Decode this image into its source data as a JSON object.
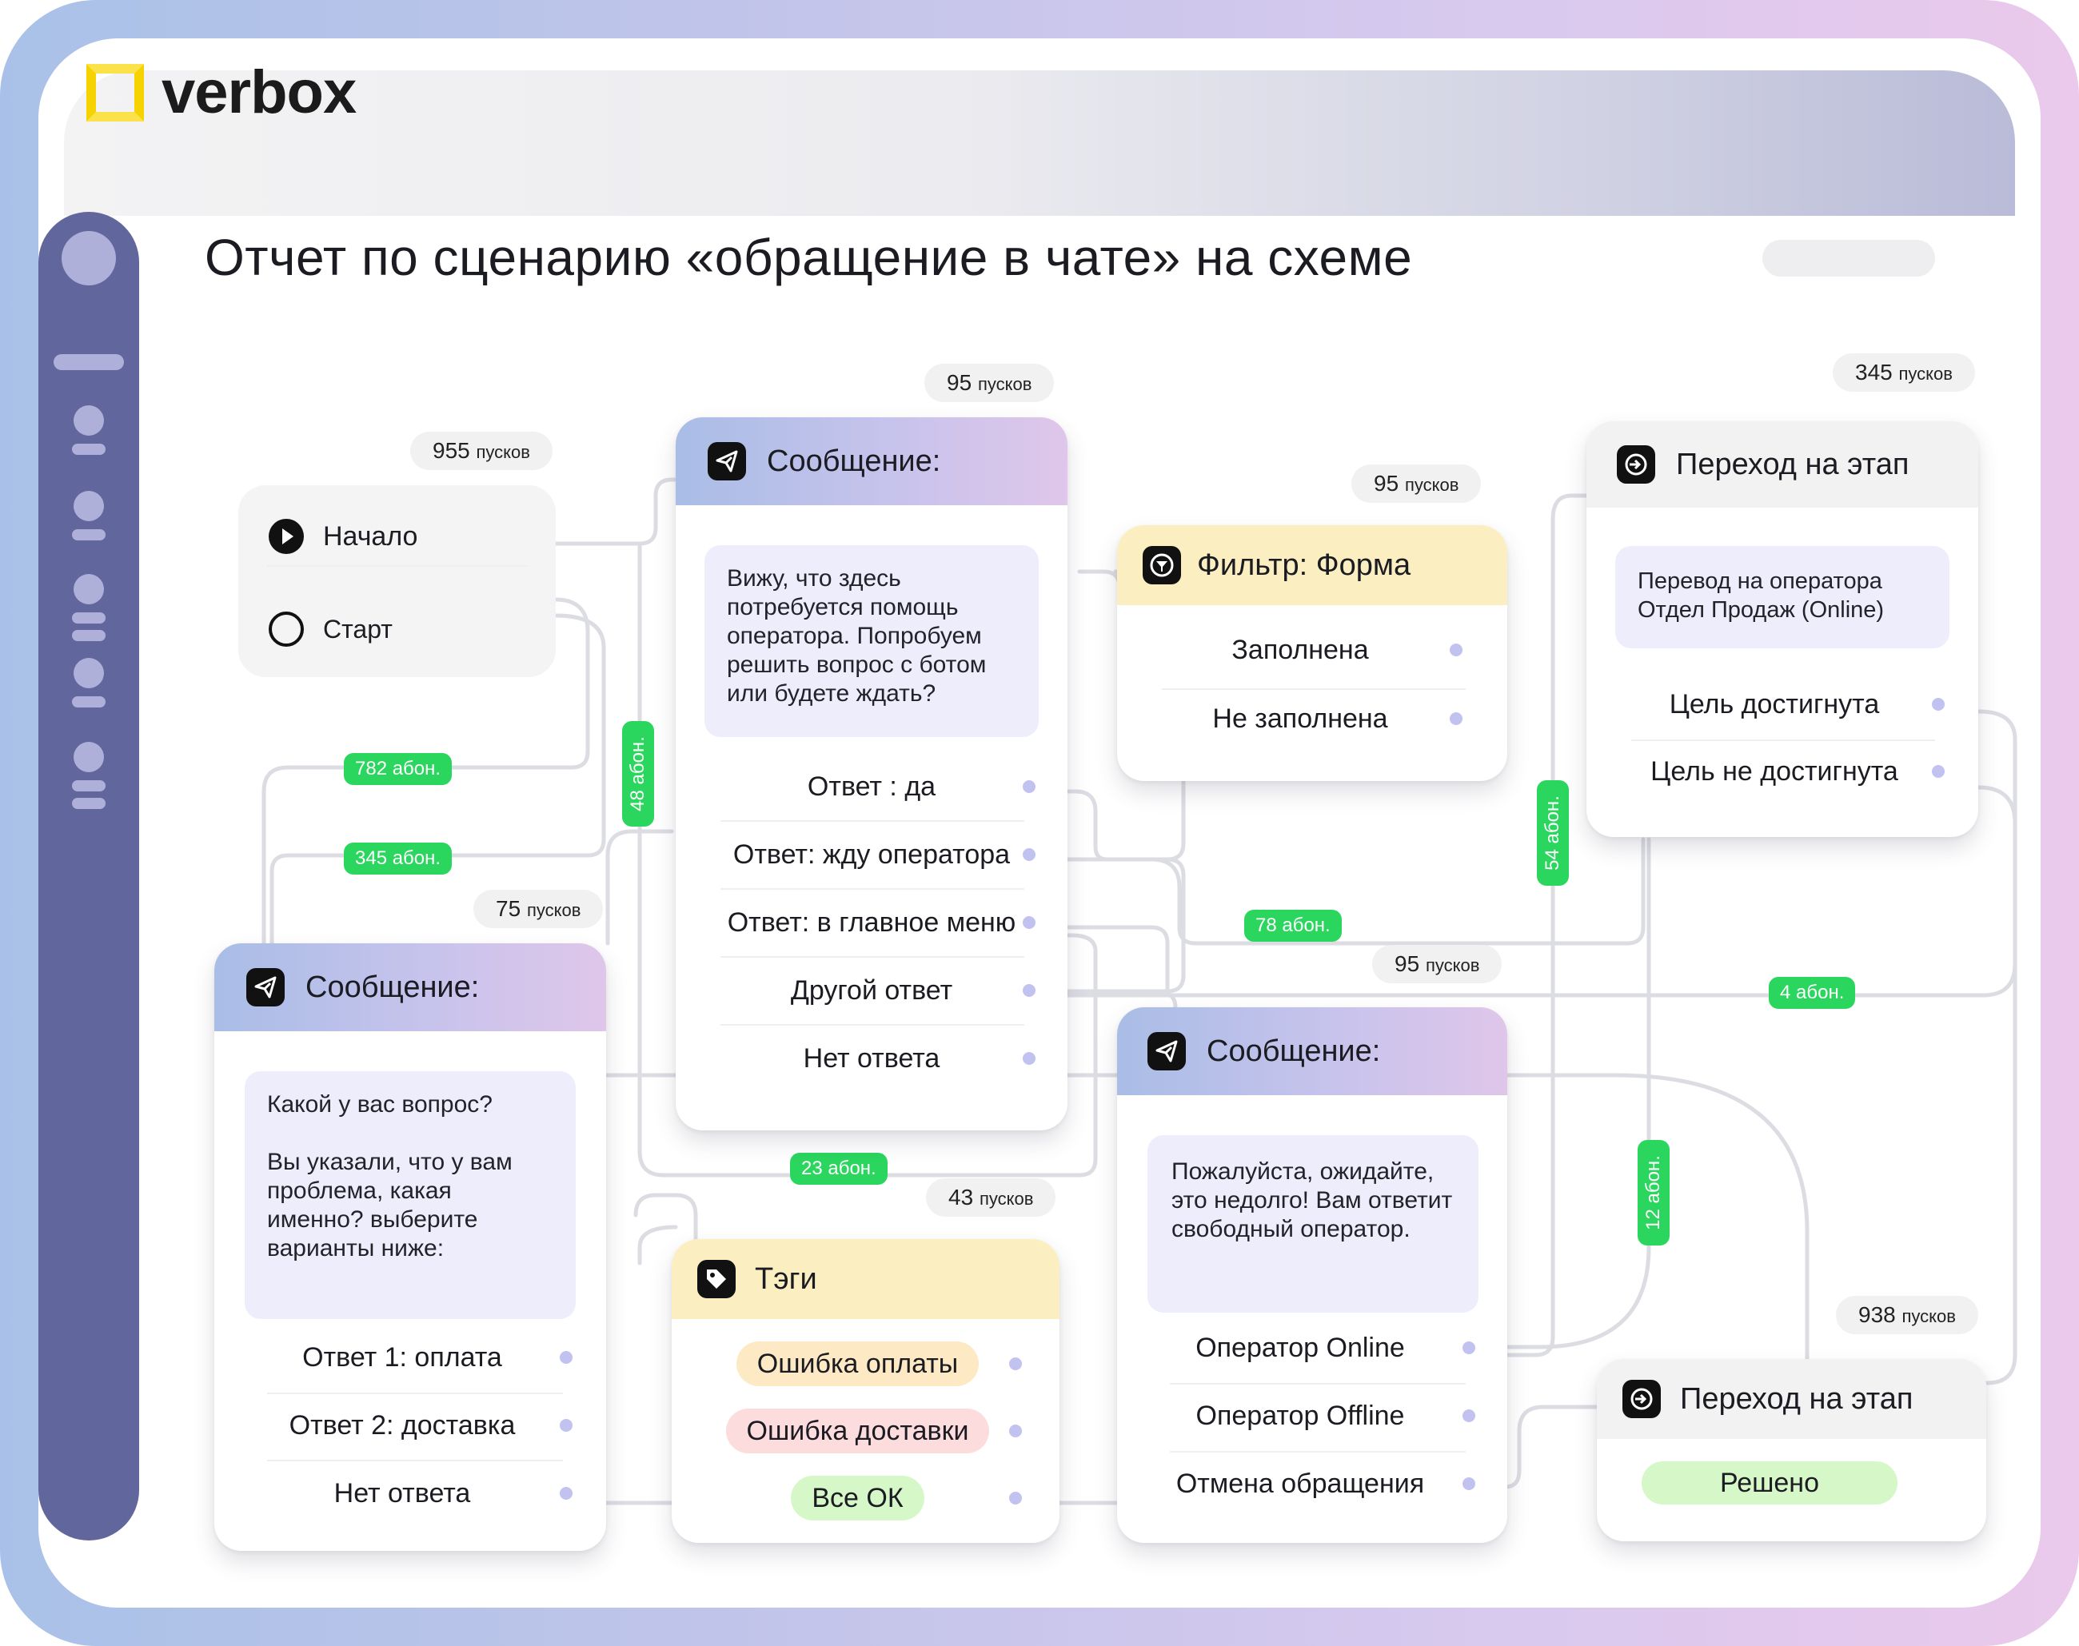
{
  "brand": {
    "name": "verbox",
    "logo_icon": "square-frame-icon",
    "accent": "#fce24a"
  },
  "title": "Отчет по сценарию «обращение в чате» на схеме",
  "sidebar_icons": [
    "avatar-icon",
    "menu-bar",
    "nav-user-icon",
    "nav-user-icon",
    "nav-group-icon",
    "nav-group-icon",
    "nav-group-icon"
  ],
  "counts": {
    "c955": {
      "num": "955",
      "unit": "пусков"
    },
    "c95a": {
      "num": "95",
      "unit": "пусков"
    },
    "c95b": {
      "num": "95",
      "unit": "пусков"
    },
    "c95c": {
      "num": "95",
      "unit": "пусков"
    },
    "c345": {
      "num": "345",
      "unit": "пусков"
    },
    "c75": {
      "num": "75",
      "unit": "пусков"
    },
    "c43": {
      "num": "43",
      "unit": "пусков"
    },
    "c938": {
      "num": "938",
      "unit": "пусков"
    }
  },
  "abonents": {
    "a782": "782 абон.",
    "a345": "345 абон.",
    "a48": "48 абон.",
    "a78": "78 абон.",
    "a54": "54 абон.",
    "a4": "4 абон.",
    "a23": "23 абон.",
    "a12": "12 абон."
  },
  "start_card": {
    "row1": "Начало",
    "row2": "Старт"
  },
  "msg_top": {
    "header": "Сообщение:",
    "bubble": "Вижу, что здесь потребуется помощь оператора.  Попробуем решить вопрос с ботом или будете ждать?",
    "rows": [
      "Ответ : да",
      "Ответ: жду оператора",
      "Ответ: в главное меню",
      "Другой ответ",
      "Нет ответа"
    ]
  },
  "filter_card": {
    "header": "Фильтр: Форма",
    "rows": [
      "Заполнена",
      "Не заполнена"
    ]
  },
  "stage_top": {
    "header": "Переход на этап",
    "bubble_line1": "Перевод на оператора",
    "bubble_line2": "Отдел Продаж (Online)",
    "rows": [
      "Цель достигнута",
      "Цель не достигнута"
    ]
  },
  "msg_left": {
    "header": "Сообщение:",
    "bubble_line1": "Какой у вас вопрос?",
    "bubble_line2": "Вы указали, что у вам проблема, какая именно? выберите варианты ниже:",
    "rows": [
      "Ответ 1: оплата",
      "Ответ 2: доставка",
      "Нет ответа"
    ]
  },
  "tags_card": {
    "header": "Тэги",
    "tags": [
      {
        "label": "Ошибка оплаты",
        "color": "#fde9c4"
      },
      {
        "label": "Ошибка доставки",
        "color": "#fcdcdc"
      },
      {
        "label": "Все ОК",
        "color": "#d6f7c7"
      }
    ]
  },
  "msg_mid": {
    "header": "Сообщение:",
    "bubble": "Пожалуйста, ожидайте, это недолго! Вам ответит свободный оператор.",
    "rows": [
      "Оператор Online",
      "Оператор Offline",
      "Отмена обращения"
    ]
  },
  "stage_bottom": {
    "header": "Переход на этап",
    "pill": "Решено"
  }
}
